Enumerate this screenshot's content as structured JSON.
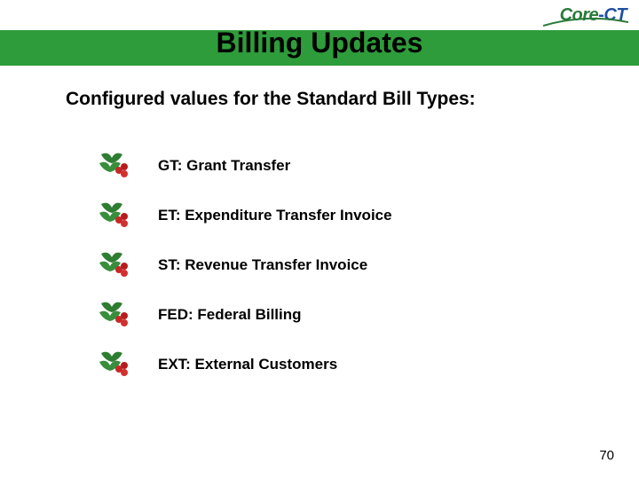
{
  "logo": {
    "brand_a": "Core",
    "dash": "-",
    "brand_b": "CT"
  },
  "title": "Billing Updates",
  "subtitle": "Configured values for the Standard Bill Types:",
  "items": [
    {
      "text": "GT:  Grant Transfer"
    },
    {
      "text": "ET:  Expenditure Transfer Invoice"
    },
    {
      "text": "ST:  Revenue Transfer Invoice"
    },
    {
      "text": "FED:  Federal Billing"
    },
    {
      "text": "EXT:  External Customers"
    }
  ],
  "page_number": "70"
}
